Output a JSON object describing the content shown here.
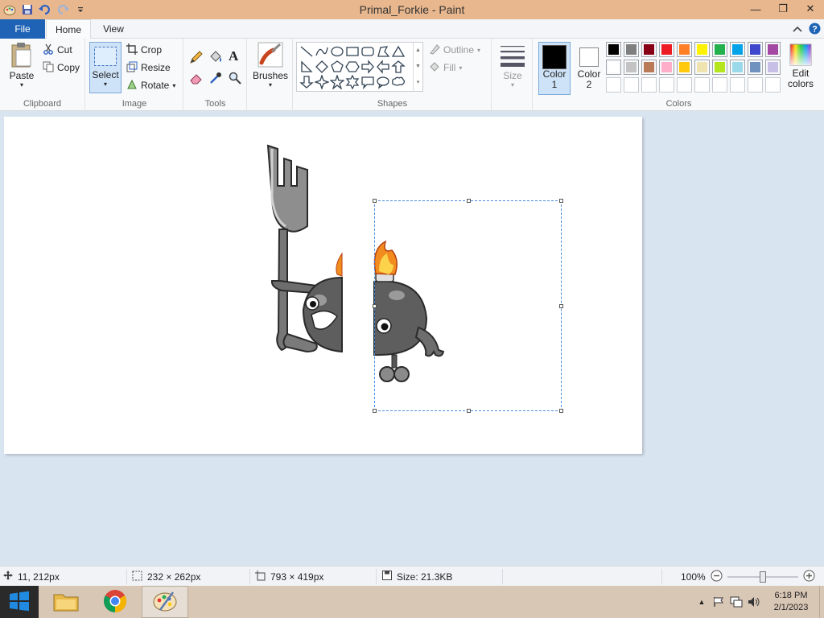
{
  "window": {
    "title": "Primal_Forkie - Paint",
    "minimize_glyph": "—",
    "restore_glyph": "❐",
    "close_glyph": "✕"
  },
  "tabs": {
    "file": "File",
    "home": "Home",
    "view": "View"
  },
  "clipboard": {
    "paste": "Paste",
    "cut": "Cut",
    "copy": "Copy",
    "label": "Clipboard"
  },
  "image": {
    "select": "Select",
    "crop": "Crop",
    "resize": "Resize",
    "rotate": "Rotate",
    "label": "Image"
  },
  "tools": {
    "label": "Tools",
    "text_tool": "A"
  },
  "brushes": {
    "label": "Brushes"
  },
  "shapes": {
    "outline": "Outline",
    "fill": "Fill",
    "label": "Shapes"
  },
  "size": {
    "label": "Size"
  },
  "colors": {
    "color1_label": "Color",
    "color1_num": "1",
    "color2_label": "Color",
    "color2_num": "2",
    "edit_label_1": "Edit",
    "edit_label_2": "colors",
    "label": "Colors",
    "color1_value": "#000000",
    "color2_value": "#ffffff",
    "palette_row1": [
      "#000000",
      "#7f7f7f",
      "#880015",
      "#ed1c24",
      "#ff7f27",
      "#fff200",
      "#22b14c",
      "#00a2e8",
      "#3f48cc",
      "#a349a4"
    ],
    "palette_row2": [
      "#ffffff",
      "#c3c3c3",
      "#b97a57",
      "#ffaec9",
      "#ffc90e",
      "#efe4b0",
      "#b5e61d",
      "#99d9ea",
      "#7092be",
      "#c8bfe7"
    ]
  },
  "status": {
    "cursor_pos": "11, 212px",
    "selection_size": "232 × 262px",
    "image_size": "793 × 419px",
    "file_size": "Size: 21.3KB",
    "zoom": "100%"
  },
  "clock": {
    "time": "6:18 PM",
    "date": "2/1/2023"
  }
}
